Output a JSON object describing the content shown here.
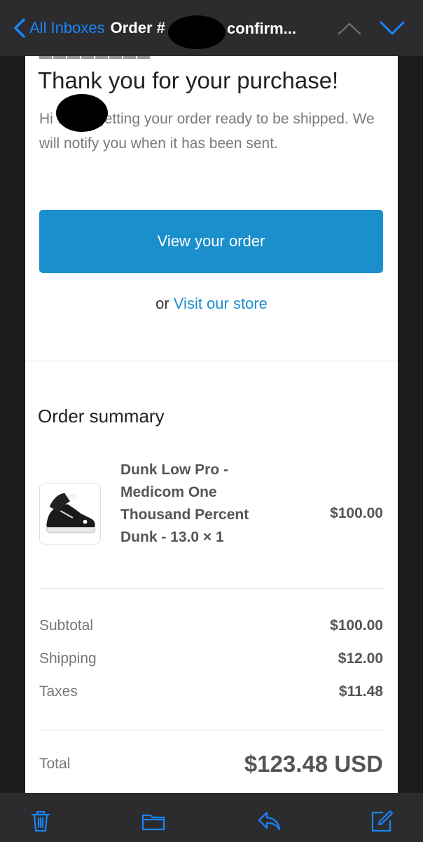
{
  "navbar": {
    "back_label": "All Inboxes",
    "title_prefix": "Order #",
    "title_suffix": "confirm..."
  },
  "email": {
    "heading": "Thank you for your purchase!",
    "intro": "Hi       we're getting your order ready to be shipped. We will notify you when it has been sent.",
    "cta_label": "View your order",
    "alt_prefix": "or",
    "alt_link": "Visit our store",
    "summary_title": "Order summary",
    "product": {
      "name": "Dunk Low Pro - Medicom One Thousand Percent Dunk - 13.0 × 1",
      "price": "$100.00"
    },
    "totals": [
      {
        "label": "Subtotal",
        "value": "$100.00"
      },
      {
        "label": "Shipping",
        "value": "$12.00"
      },
      {
        "label": "Taxes",
        "value": "$11.48"
      }
    ],
    "total_label": "Total",
    "total_value": "$123.48 USD"
  },
  "toolbar": {
    "icons": [
      "trash-icon",
      "folder-icon",
      "reply-icon",
      "compose-icon"
    ]
  },
  "colors": {
    "accent": "#1a84ff",
    "cta": "#1b8fcc",
    "chrome": "#2c2c2e"
  }
}
